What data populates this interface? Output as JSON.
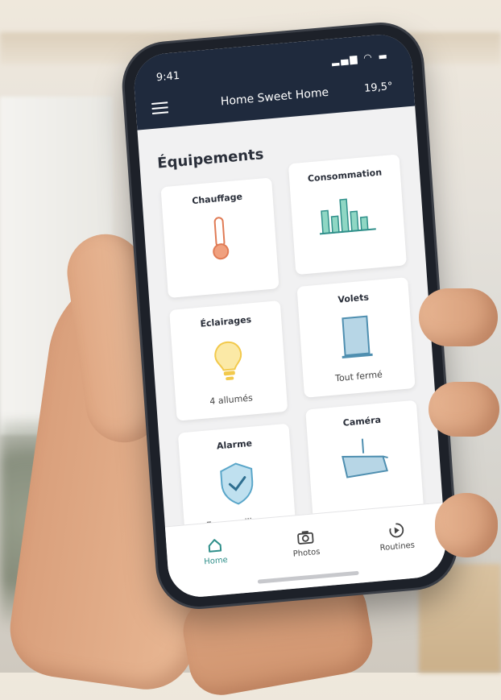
{
  "status": {
    "time": "9:41",
    "icons": "signal wifi battery"
  },
  "header": {
    "title": "Home Sweet Home",
    "temperature": "19,5°"
  },
  "section": {
    "title": "Équipements"
  },
  "cards": [
    {
      "title": "Chauffage",
      "subtitle": ""
    },
    {
      "title": "Consommation",
      "subtitle": ""
    },
    {
      "title": "Éclairages",
      "subtitle": "4 allumés"
    },
    {
      "title": "Volets",
      "subtitle": "Tout fermé"
    },
    {
      "title": "Alarme",
      "subtitle": "En surveillance"
    },
    {
      "title": "Caméra",
      "subtitle": ""
    }
  ],
  "nav": [
    {
      "label": "Home"
    },
    {
      "label": "Photos"
    },
    {
      "label": "Routines"
    }
  ],
  "colors": {
    "header_bg": "#1f2a3d",
    "accent_teal": "#2f8f8a",
    "thermo_orange": "#e07b55",
    "bulb_yellow": "#f2c94c",
    "shield_blue": "#5aa6c9",
    "shutter_blue": "#4f8fb0"
  }
}
